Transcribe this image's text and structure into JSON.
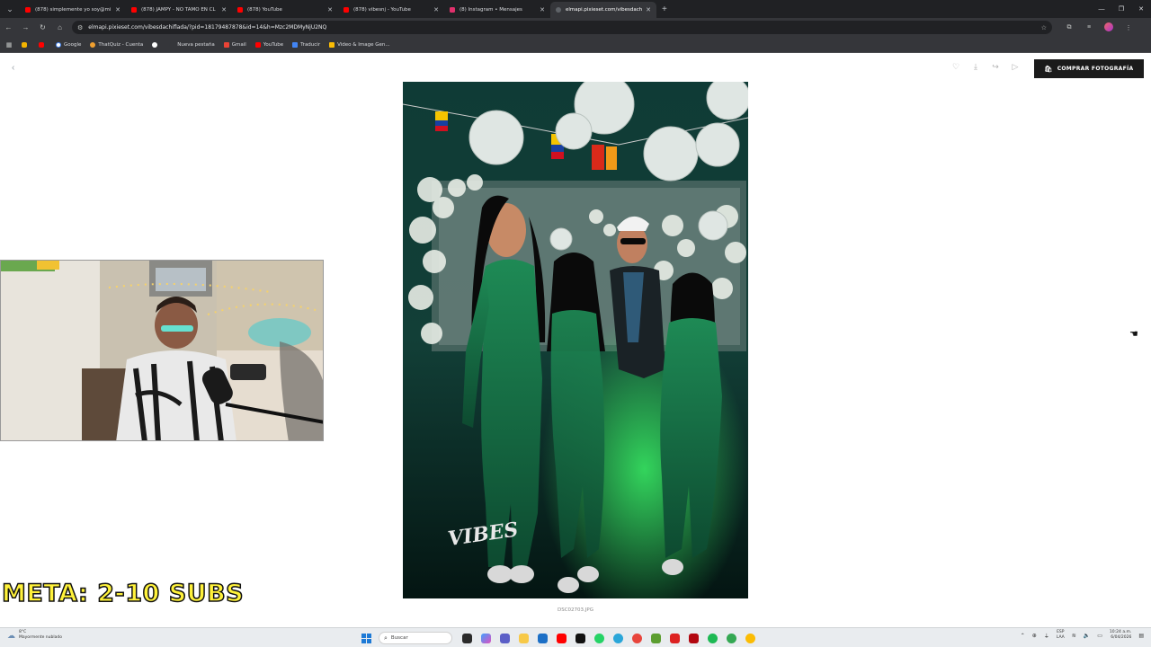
{
  "browser": {
    "tabs": [
      {
        "title": "(878) simplemente yo soy@mi",
        "favicon": "youtube",
        "active": false
      },
      {
        "title": "(878) JAMPY - NO TAMO EN CL",
        "favicon": "youtube",
        "active": false
      },
      {
        "title": "(878) YouTube",
        "favicon": "youtube",
        "active": false
      },
      {
        "title": "(878) vibesnj - YouTube",
        "favicon": "youtube",
        "active": false
      },
      {
        "title": "(8) Instagram • Mensajes",
        "favicon": "instagram",
        "active": false
      },
      {
        "title": "elmapi.pixieset.com/vibesdachi",
        "favicon": "pixieset",
        "active": true
      }
    ],
    "url": "elmapi.pixieset.com/vibesdachiflada/?pid=18179487878&id=14&h=Mzc2MDMyNjU2NQ",
    "bookmarks": [
      {
        "label": "",
        "color": "#f4b400"
      },
      {
        "label": "",
        "color": "#ff0000"
      },
      {
        "label": "Google",
        "color": "#ffffff"
      },
      {
        "label": "ThatQuiz - Cuenta",
        "color": "#f0a030"
      },
      {
        "label": "",
        "color": "#ffffff"
      },
      {
        "label": "Nueva pestaña",
        "color": "#35363a"
      },
      {
        "label": "Gmail",
        "color": "#ea4335"
      },
      {
        "label": "YouTube",
        "color": "#ff0000"
      },
      {
        "label": "Traducir",
        "color": "#4285f4"
      },
      {
        "label": "Video & Image Gen...",
        "color": "#fbbc04"
      }
    ]
  },
  "page": {
    "buy_button": "COMPRAR FOTOGRAFÍA",
    "filename": "DSC02703.JPG",
    "photo_watermark": "VIBES"
  },
  "stream": {
    "goal_text": "META: 2-10 SUBS"
  },
  "taskbar": {
    "weather_temp": "8°C",
    "weather_desc": "Mayormente nublado",
    "search_placeholder": "Buscar",
    "lang_top": "ESP",
    "lang_bottom": "LAA",
    "time": "10:24 a.m.",
    "date": "6/04/2026"
  }
}
